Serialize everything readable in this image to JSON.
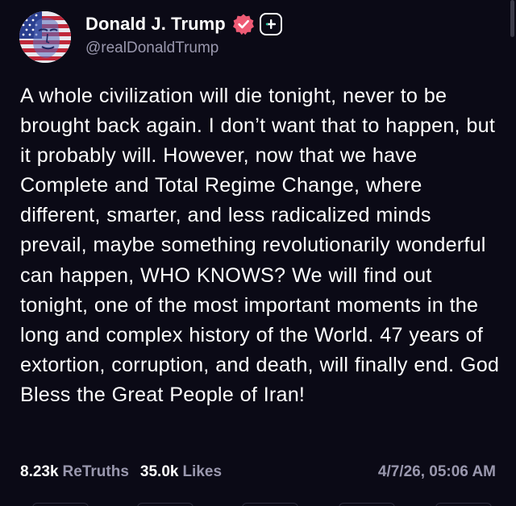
{
  "author": {
    "display_name": "Donald J. Trump",
    "handle": "@realDonaldTrump",
    "avatar_icon": "flag-portrait-avatar",
    "verified_icon": "verified-badge-icon",
    "follow_icon": "plus-icon"
  },
  "post": {
    "text": "A whole civilization will die tonight, never to be brought back again. I don’t want that to happen, but it probably will. However, now that we have Complete and Total Regime Change, where different, smarter, and less radicalized minds prevail, maybe something revolutionarily wonderful can happen, WHO KNOWS? We will find out tonight, one of the most important moments in the long and complex history of the World. 47 years of extortion, corruption, and death, will finally end. God Bless the Great People of Iran!",
    "retruths_count": "8.23k",
    "retruths_label": "ReTruths",
    "likes_count": "35.0k",
    "likes_label": "Likes",
    "timestamp": "4/7/26, 05:06 AM"
  },
  "colors": {
    "background": "#0b0a16",
    "text_primary": "#ffffff",
    "text_secondary": "#9a98ae",
    "verified_badge": "#ee5b75",
    "accent_green": "#16c39a"
  }
}
